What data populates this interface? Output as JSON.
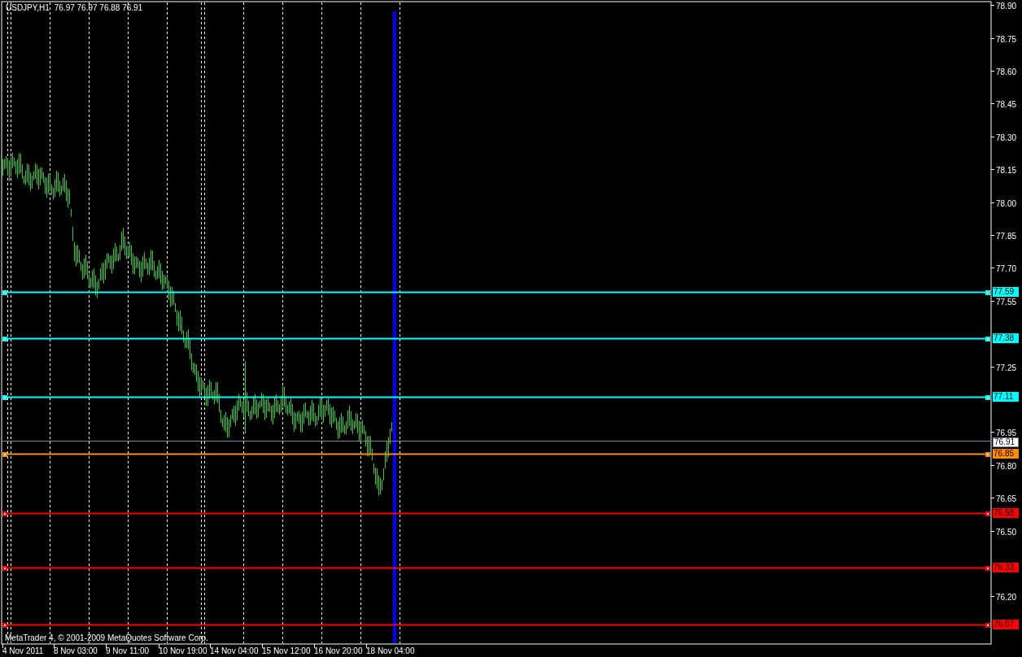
{
  "chart": {
    "symbol": "USDJPY,H1",
    "ohlc": "76.97 76.97 76.88 76.91",
    "price_axis": [
      "78.90",
      "78.75",
      "78.60",
      "78.45",
      "78.30",
      "78.15",
      "78.00",
      "77.85",
      "77.70",
      "77.55",
      "77.25",
      "76.95",
      "76.80",
      "76.65",
      "76.50",
      "76.20"
    ],
    "time_axis": [
      "4 Nov 2011",
      "8 Nov 03:00",
      "9 Nov 11:00",
      "10 Nov 19:00",
      "14 Nov 04:00",
      "15 Nov 12:00",
      "16 Nov 20:00",
      "18 Nov 04:00"
    ],
    "levels": [
      {
        "label": "77.59",
        "color": "#00ffff",
        "kind": "line"
      },
      {
        "label": "77.38",
        "color": "#00ffff",
        "kind": "line"
      },
      {
        "label": "77.11",
        "color": "#00ffff",
        "kind": "line"
      },
      {
        "label": "76.91",
        "color": "#778899",
        "kind": "bid"
      },
      {
        "label": "76.85",
        "color": "#ff8c00",
        "kind": "line"
      },
      {
        "label": "76.58",
        "color": "#ff0000",
        "kind": "line"
      },
      {
        "label": "76.33",
        "color": "#ff0000",
        "kind": "line"
      },
      {
        "label": "76.07",
        "color": "#ff0000",
        "kind": "line"
      }
    ],
    "copyright": "MetaTrader 4, © 2001-2009 MetaQuotes Software Corp."
  }
}
